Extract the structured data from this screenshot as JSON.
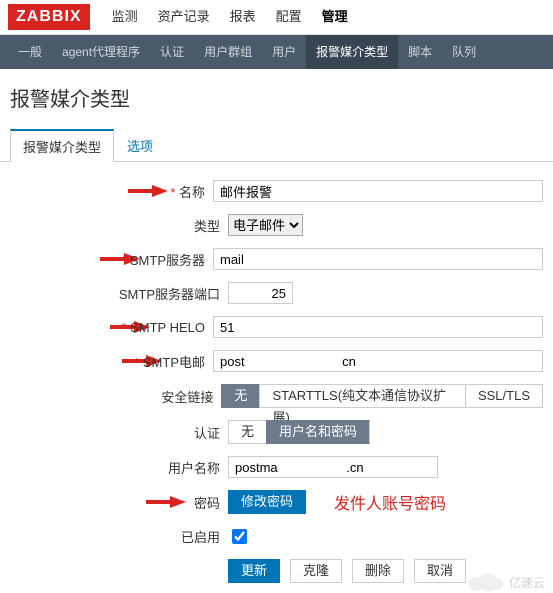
{
  "logo": "ZABBIX",
  "mainnav": [
    "监测",
    "资产记录",
    "报表",
    "配置",
    "管理"
  ],
  "mainnav_selected": 4,
  "subnav": [
    "一般",
    "agent代理程序",
    "认证",
    "用户群组",
    "用户",
    "报警媒介类型",
    "脚本",
    "队列"
  ],
  "subnav_selected": 5,
  "page_title": "报警媒介类型",
  "tabs": {
    "main": "报警媒介类型",
    "options": "选项"
  },
  "form": {
    "name_label": "名称",
    "name_value": "邮件报警",
    "type_label": "类型",
    "type_value": "电子邮件",
    "smtp_server_label": "SMTP服务器",
    "smtp_server_value": "mail",
    "smtp_port_label": "SMTP服务器端口",
    "smtp_port_value": "25",
    "smtp_helo_label": "SMTP HELO",
    "smtp_helo_value": "51",
    "smtp_email_label": "SMTP电邮",
    "smtp_email_value": "post                           cn",
    "security_label": "安全链接",
    "security_opts": {
      "none": "无",
      "starttls": "STARTTLS(纯文本通信协议扩展)",
      "ssl": "SSL/TLS"
    },
    "auth_label": "认证",
    "auth_opts": {
      "none": "无",
      "userpass": "用户名和密码"
    },
    "username_label": "用户名称",
    "username_value": "postma                   .cn",
    "password_label": "密码",
    "password_btn": "修改密码",
    "password_annot": "发件人账号密码",
    "enabled_label": "已启用"
  },
  "actions": {
    "update": "更新",
    "clone": "克隆",
    "delete": "删除",
    "cancel": "取消"
  },
  "watermark": "亿速云"
}
